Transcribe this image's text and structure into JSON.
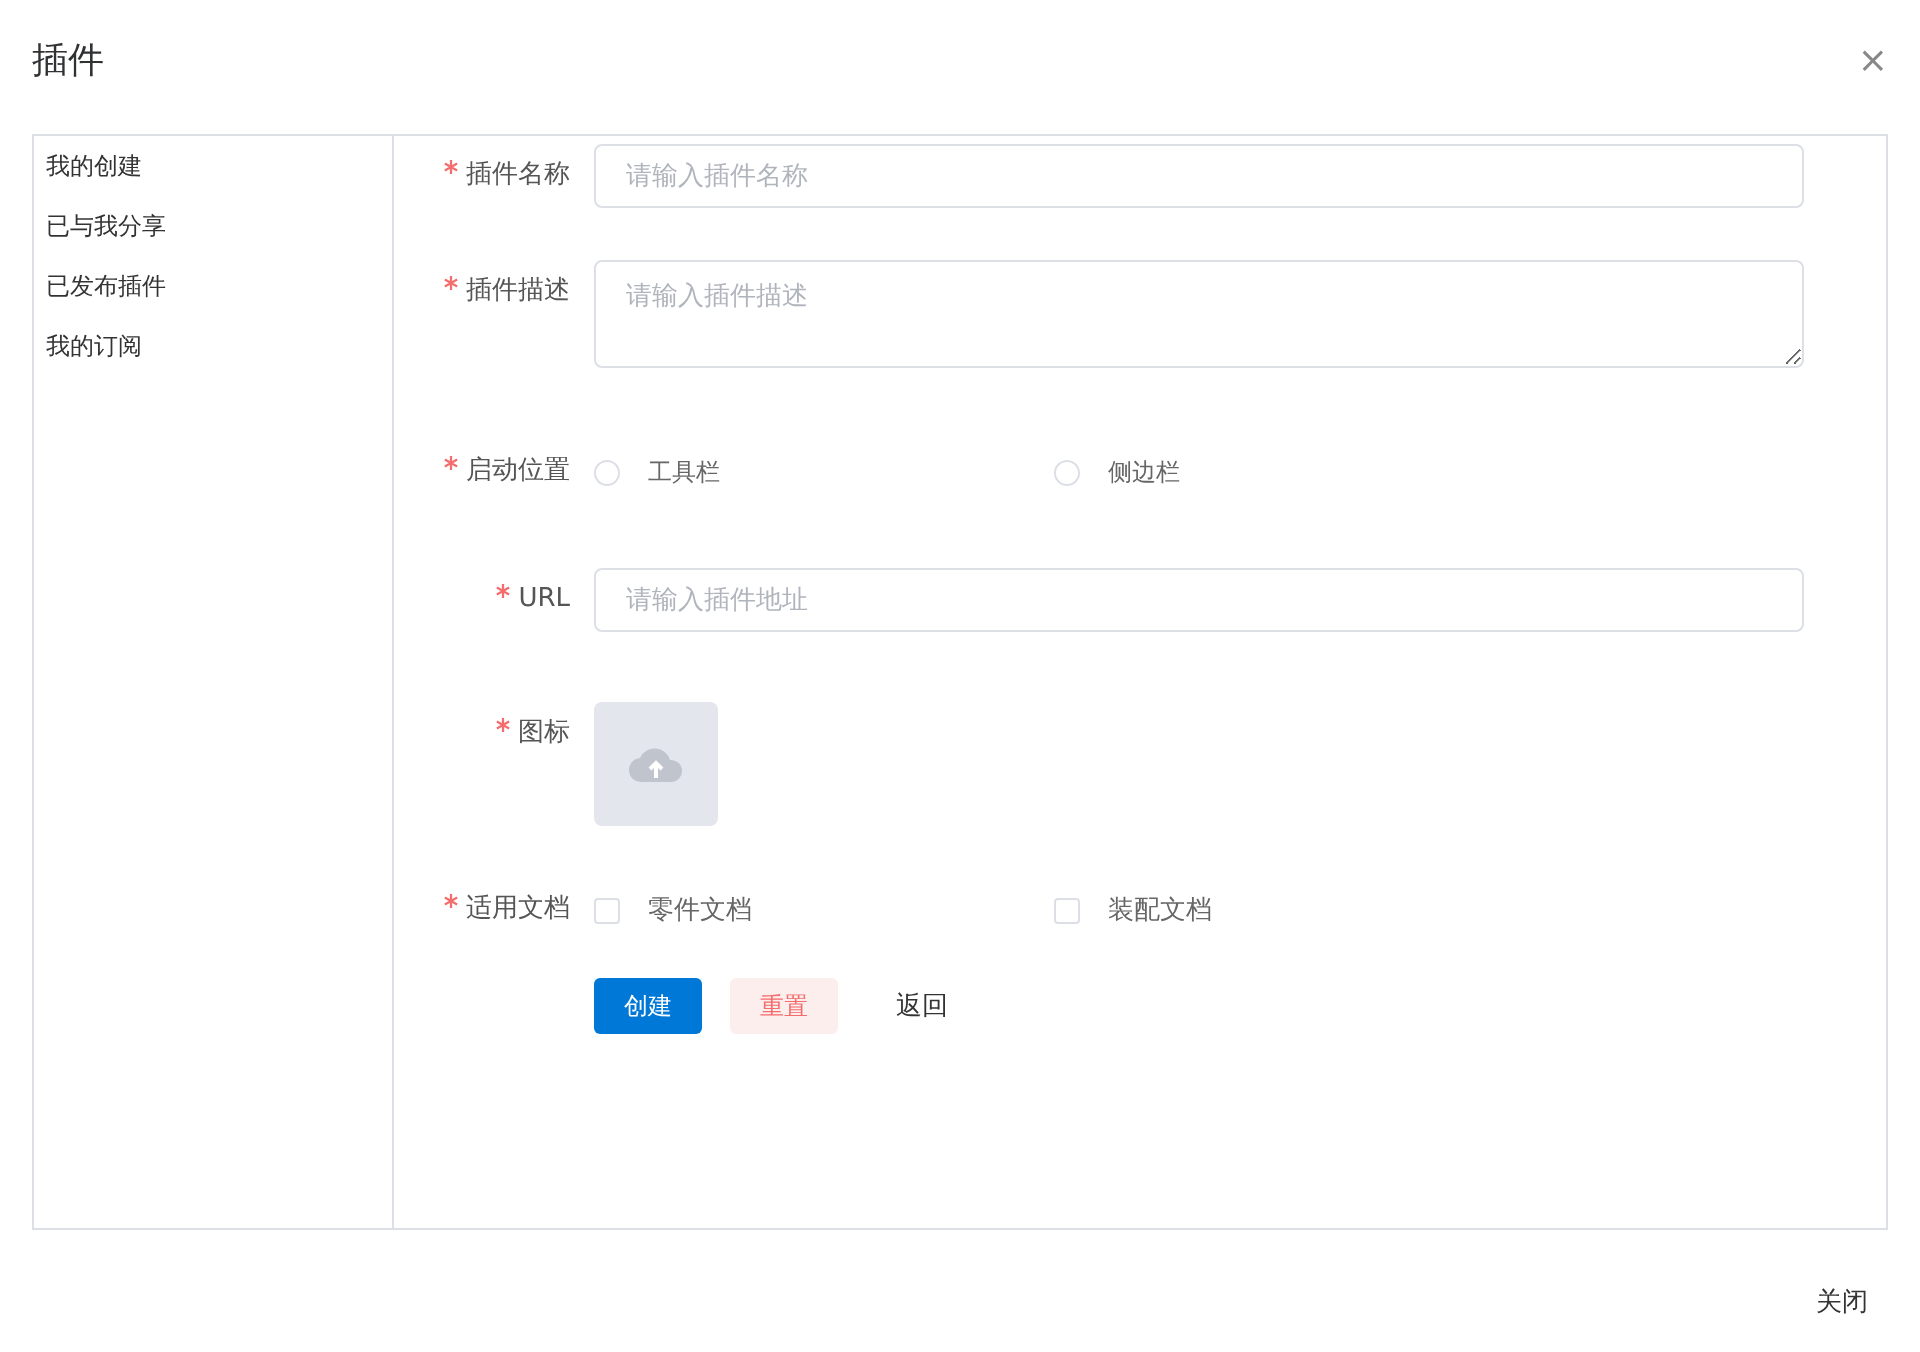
{
  "dialog": {
    "title": "插件",
    "close_icon": "×"
  },
  "sidebar": {
    "items": [
      {
        "label": "我的创建",
        "selected": false
      },
      {
        "label": "已与我分享",
        "selected": false
      },
      {
        "label": "已发布插件",
        "selected": false
      },
      {
        "label": "我的订阅",
        "selected": false
      }
    ]
  },
  "form": {
    "fields": [
      {
        "kind": "input",
        "label": "插件名称",
        "required": true,
        "placeholder": "请输入插件名称"
      },
      {
        "kind": "textarea",
        "label": "插件描述",
        "required": true,
        "placeholder": "请输入插件描述"
      },
      {
        "kind": "radio",
        "label": "启动位置",
        "required": true,
        "options": [
          {
            "label": "工具栏",
            "selected": false
          },
          {
            "label": "侧边栏",
            "selected": false
          }
        ]
      },
      {
        "kind": "input",
        "label": "URL",
        "required": true,
        "placeholder": "请输入插件地址"
      },
      {
        "kind": "upload",
        "label": "图标",
        "required": true
      },
      {
        "kind": "checkbox",
        "label": "适用文档",
        "required": true,
        "options": [
          {
            "label": "零件文档",
            "checked": false
          },
          {
            "label": "装配文档",
            "checked": false
          }
        ]
      }
    ],
    "buttons": [
      {
        "label": "创建",
        "kind": "primary"
      },
      {
        "label": "重置",
        "kind": "danger"
      },
      {
        "label": "返回",
        "kind": "text"
      }
    ]
  },
  "footer": {
    "buttons": [
      "关闭"
    ]
  }
}
